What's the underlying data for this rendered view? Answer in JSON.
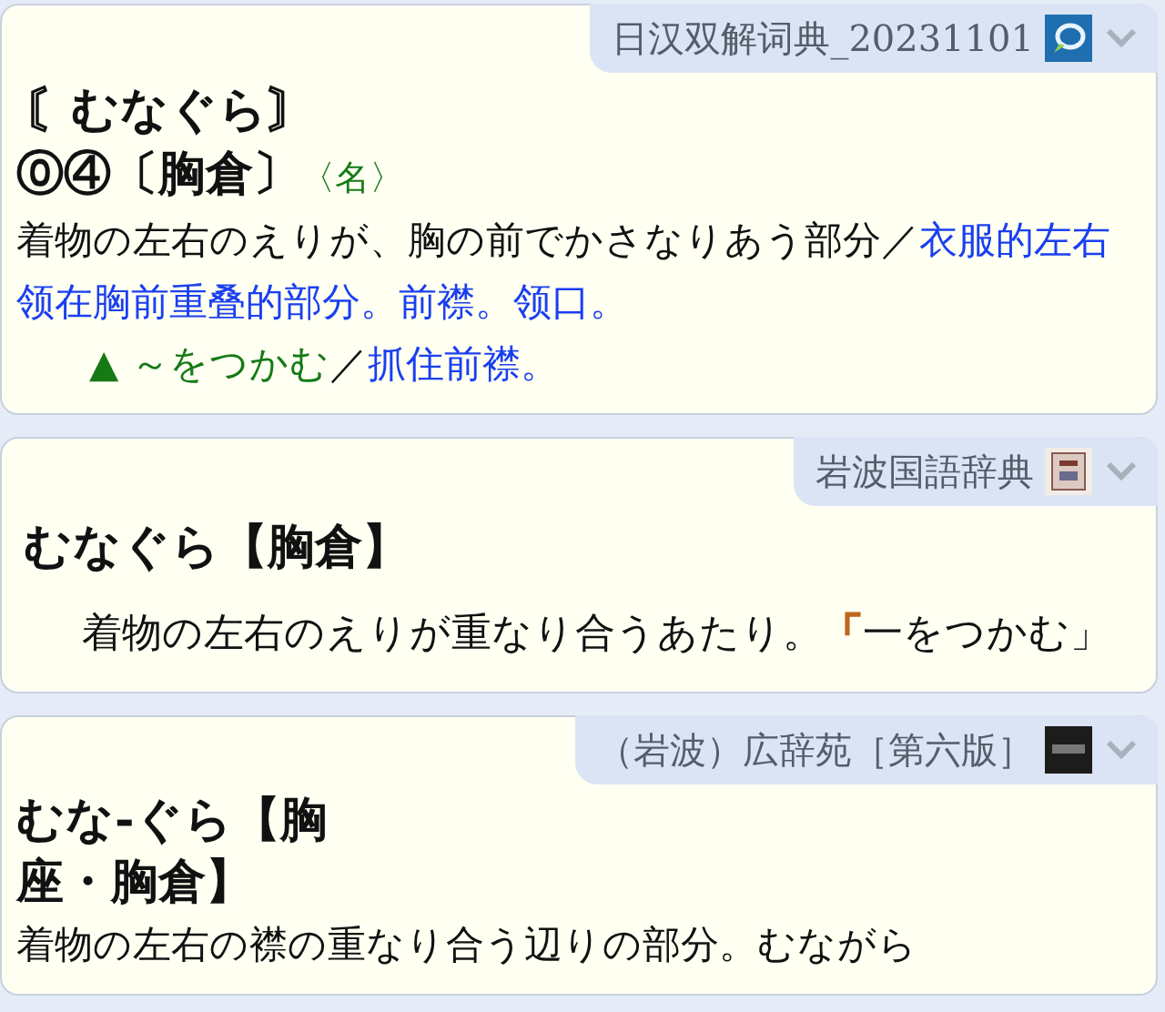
{
  "cards": [
    {
      "dictionary": "日汉双解词典_20231101",
      "blocks": [
        {
          "kind": "headword",
          "segments": [
            {
              "text": "〘むなぐら〙",
              "color": "#111111"
            }
          ]
        },
        {
          "kind": "accent",
          "segments": [
            {
              "text": "⓪④〔胸倉〕",
              "color": "#111111"
            },
            {
              "text": "〈名〉",
              "color": "#157a15"
            }
          ]
        },
        {
          "kind": "definition",
          "segments": [
            {
              "text": "着物の左右のえりが、胸の前でかさなりあう部分",
              "color": "#111111"
            },
            {
              "text": "／",
              "color": "#111111"
            },
            {
              "text": "衣服的左右领在胸前重叠的部分。前襟。领口。",
              "color": "#1a3ff0"
            }
          ]
        },
        {
          "kind": "example",
          "segments": [
            {
              "text": "▲ ～をつかむ",
              "color": "#157a15"
            },
            {
              "text": "／",
              "color": "#111111"
            },
            {
              "text": "抓住前襟。",
              "color": "#1a3ff0"
            }
          ]
        }
      ]
    },
    {
      "dictionary": "岩波国語辞典",
      "blocks": [
        {
          "kind": "headword",
          "segments": [
            {
              "text": "むなぐら【胸倉】",
              "color": "#111111"
            }
          ]
        },
        {
          "kind": "indented",
          "segments": [
            {
              "text": "着物の左右のえりが重なり合うあたり。",
              "color": "#111111"
            },
            {
              "text": "「",
              "color": "#c0661a"
            },
            {
              "text": "一をつかむ」",
              "color": "#111111"
            }
          ]
        }
      ]
    },
    {
      "dictionary": "（岩波）広辞苑［第六版］",
      "blocks": [
        {
          "kind": "narrowhead",
          "segments": [
            {
              "text": "むな‐ぐら【胸座・胸倉】",
              "color": "#111111"
            }
          ]
        },
        {
          "kind": "definition",
          "segments": [
            {
              "text": "着物の左右の襟の重なり合う辺りの部分。むながら",
              "color": "#111111"
            }
          ]
        }
      ]
    }
  ]
}
